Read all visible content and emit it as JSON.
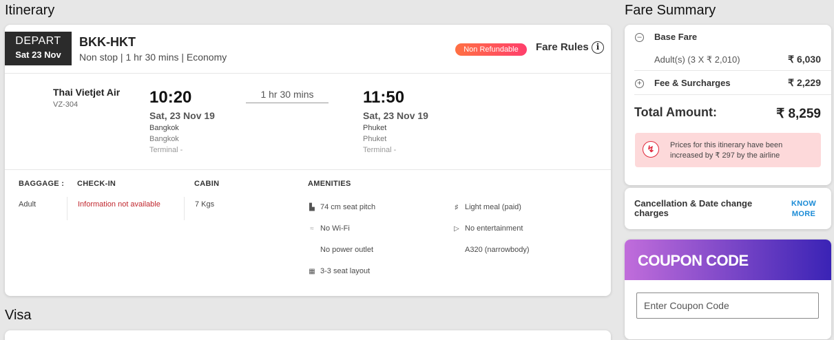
{
  "headings": {
    "itinerary": "Itinerary",
    "visa": "Visa",
    "fare_summary": "Fare Summary"
  },
  "flight": {
    "depart_label": "DEPART",
    "depart_date": "Sat 23 Nov",
    "route": "BKK-HKT",
    "route_sub": "Non stop | 1 hr 30 mins | Economy",
    "refund_badge": "Non Refundable",
    "fare_rules": "Fare Rules",
    "airline": "Thai Vietjet Air",
    "flight_no": "VZ-304",
    "dep_time": "10:20",
    "dep_date": "Sat, 23 Nov 19",
    "dep_city": "Bangkok",
    "dep_airport": "Bangkok",
    "dep_terminal": "Terminal -",
    "duration": "1 hr 30 mins",
    "arr_time": "11:50",
    "arr_date": "Sat, 23 Nov 19",
    "arr_city": "Phuket",
    "arr_airport": "Phuket",
    "arr_terminal": "Terminal -"
  },
  "baggage": {
    "baggage_head": "BAGGAGE :",
    "checkin_head": "CHECK-IN",
    "cabin_head": "CABIN",
    "amenities_head": "AMENITIES",
    "pax": "Adult",
    "checkin_val": "Information not available",
    "cabin_val": "7 Kgs"
  },
  "amenities": {
    "seat_pitch": "74 cm seat pitch",
    "wifi": "No Wi-Fi",
    "power": "No power outlet",
    "layout": "3-3 seat layout",
    "meal": "Light meal (paid)",
    "entertainment": "No entertainment",
    "aircraft": "A320 (narrowbody)"
  },
  "fare": {
    "base_fare_label": "Base Fare",
    "adults_label": "Adult(s) (3 X ₹ 2,010)",
    "adults_amount": "₹ 6,030",
    "fees_label": "Fee & Surcharges",
    "fees_amount": "₹ 2,229",
    "total_label": "Total Amount:",
    "total_amount": "₹ 8,259",
    "alert_text": "Prices for this itinerary have been increased by ₹ 297 by the airline"
  },
  "cancellation": {
    "text": "Cancellation & Date change charges",
    "link": "KNOW MORE"
  },
  "coupon": {
    "title": "COUPON CODE",
    "placeholder": "Enter Coupon Code"
  },
  "colors": {
    "accent_blue": "#1a8bd6",
    "alert_bg": "#fdd9da",
    "alert_red": "#e0273a",
    "checkin_red": "#c0262d"
  }
}
